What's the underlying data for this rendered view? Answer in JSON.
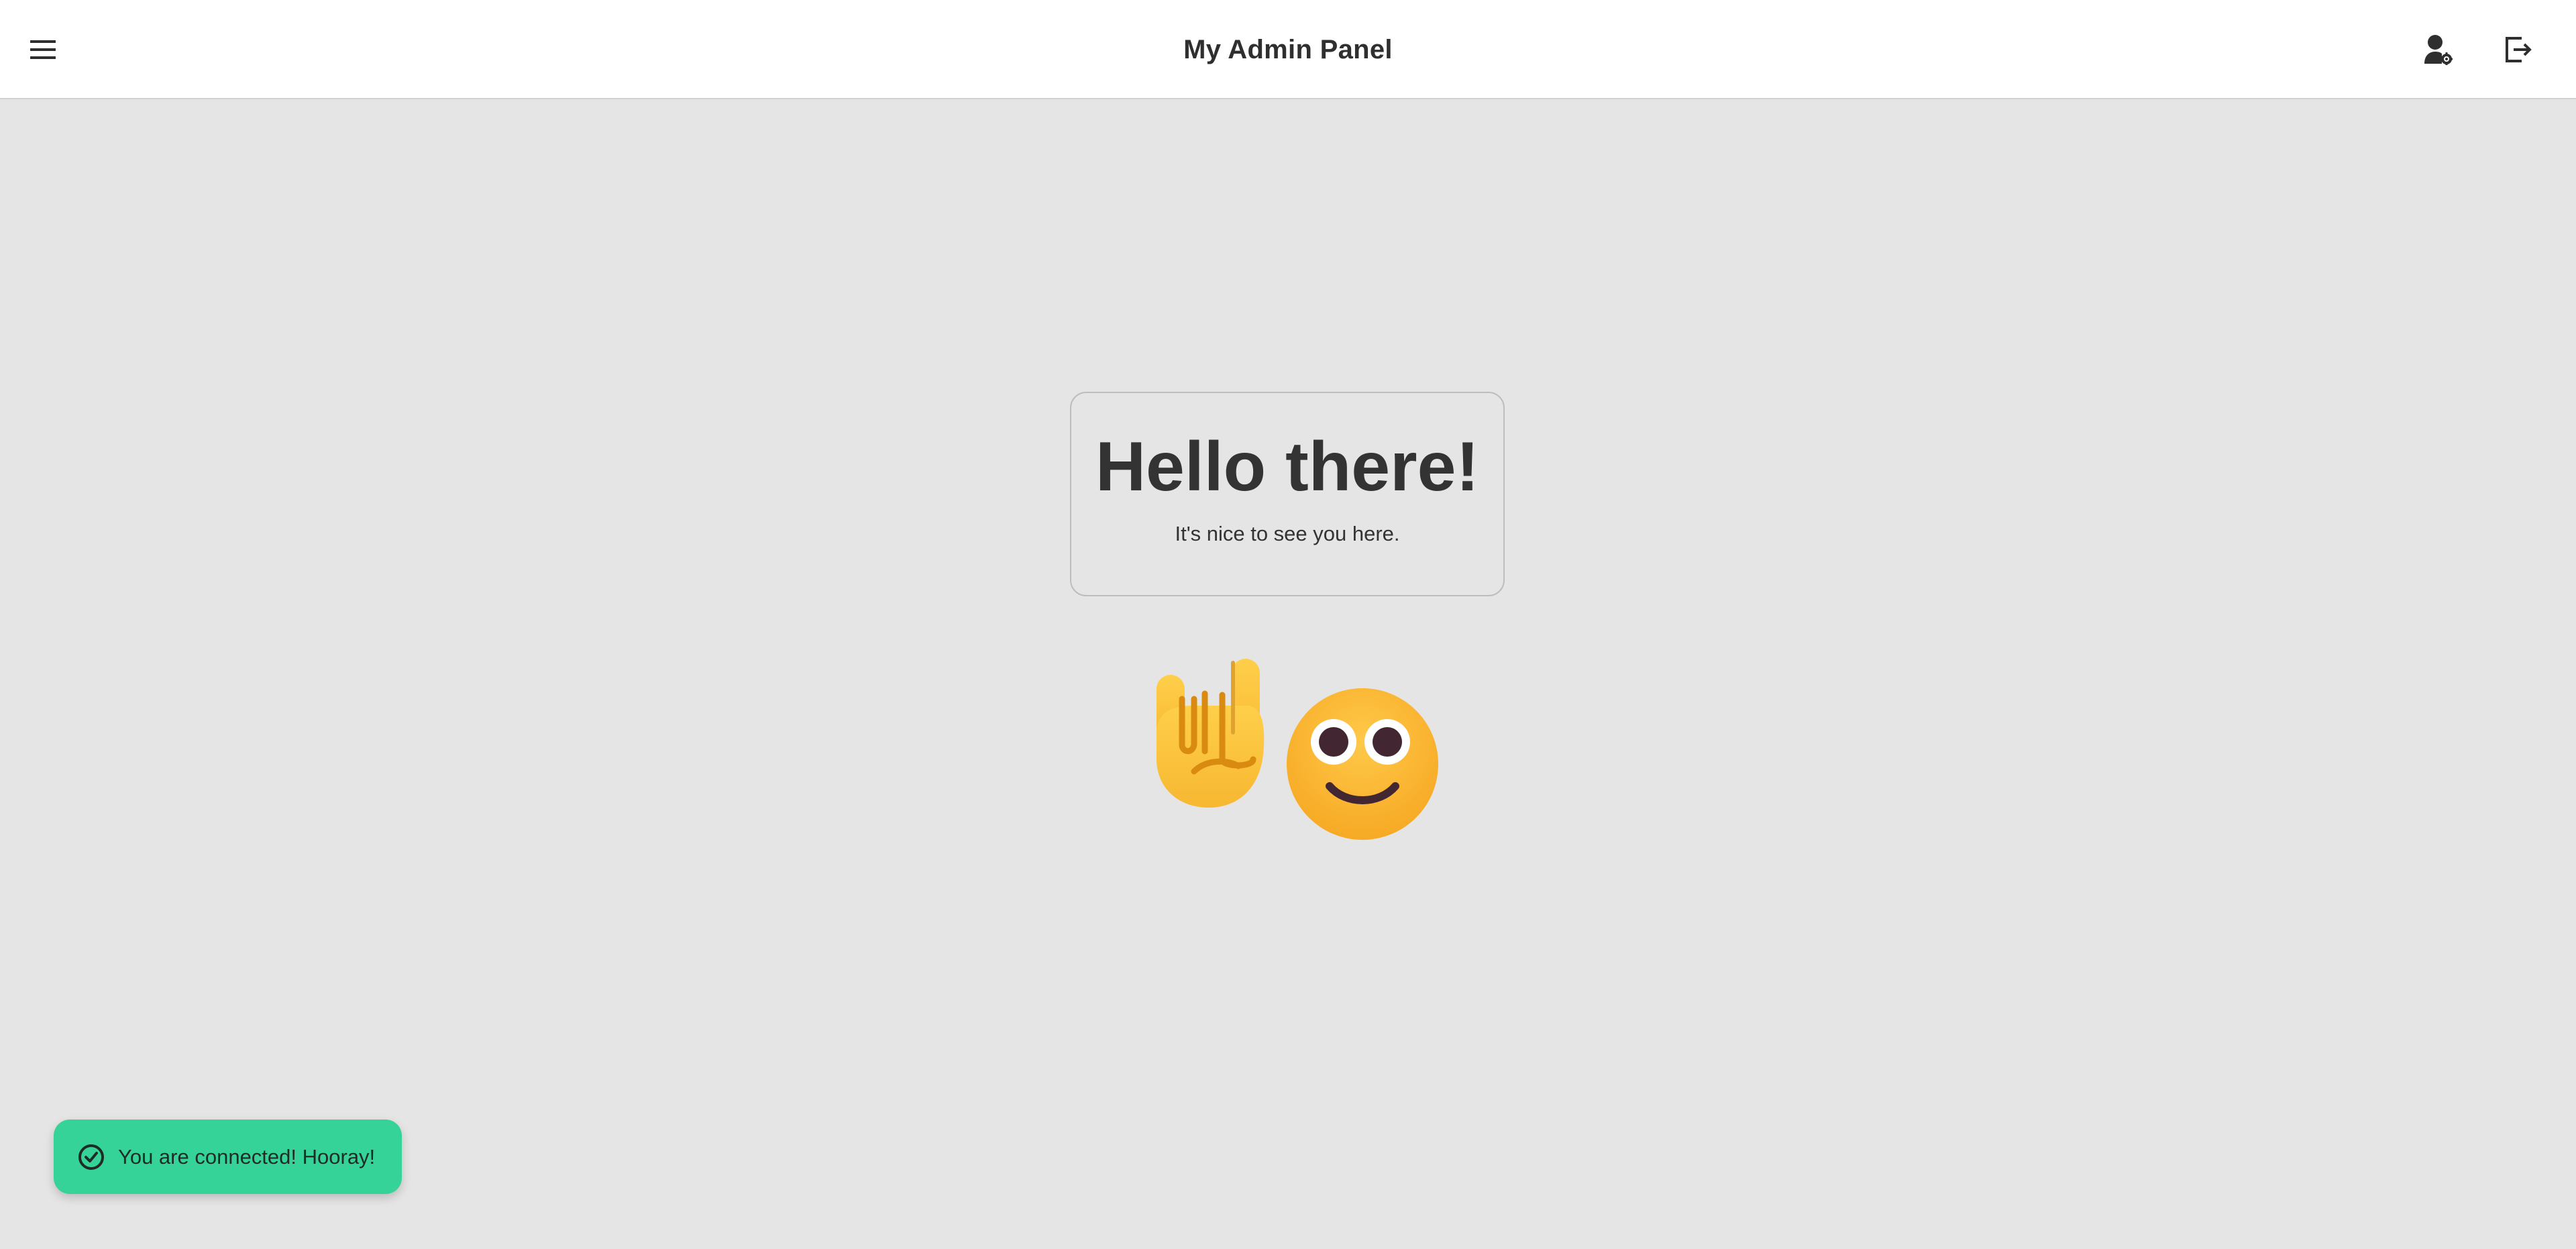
{
  "header": {
    "title": "My Admin Panel",
    "menu_icon": "hamburger-menu-icon",
    "profile_icon": "user-settings-icon",
    "logout_icon": "logout-icon"
  },
  "main": {
    "heading": "Hello there!",
    "subheading": "It's nice to see you here.",
    "emojis": [
      "sign-of-the-horns-emoji",
      "smiling-face-emoji"
    ]
  },
  "toast": {
    "message": "You are connected! Hooray!",
    "icon": "check-circle-icon",
    "color": "#36d399"
  },
  "colors": {
    "background": "#e5e5e5",
    "header_background": "#ffffff",
    "text": "#2f2f2f"
  }
}
